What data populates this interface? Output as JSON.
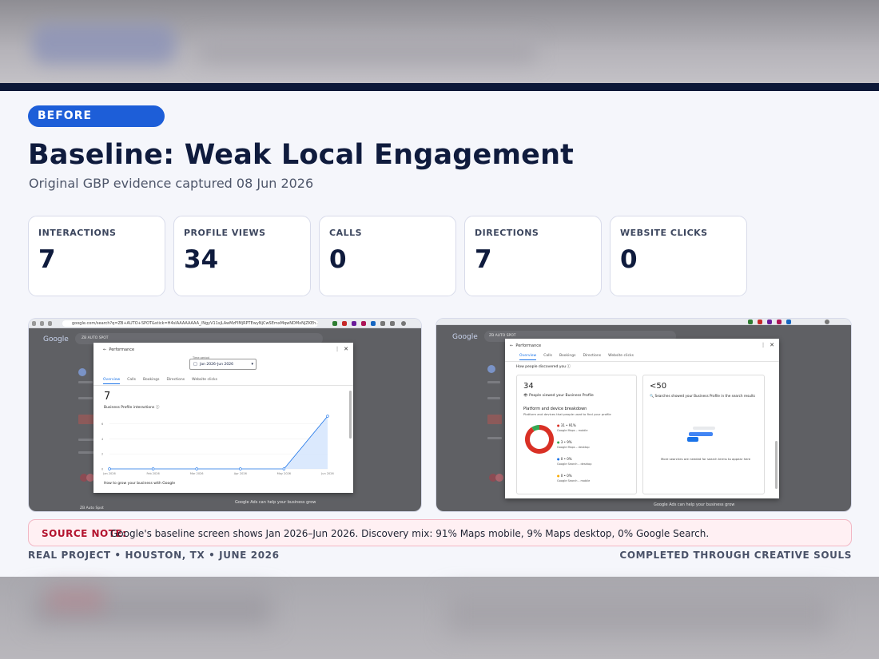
{
  "slide": {
    "badge": "BEFORE",
    "title": "Baseline: Weak Local Engagement",
    "subtitle": "Original GBP evidence captured 08 Jun 2026"
  },
  "metrics": [
    {
      "label": "INTERACTIONS",
      "value": "7"
    },
    {
      "label": "PROFILE VIEWS",
      "value": "34"
    },
    {
      "label": "CALLS",
      "value": "0"
    },
    {
      "label": "DIRECTIONS",
      "value": "7"
    },
    {
      "label": "WEBSITE CLICKS",
      "value": "0"
    }
  ],
  "screenshot_left": {
    "url": "google.com/search?q=ZB+AUTO+SPOT&stick=H4sIAAAAAAAA_/NgyV11sjLAwMzFIMjRPTEwyNjCwSEmxMqwNDMxNjZKEh...",
    "logo": "Google",
    "search_text": "ZB AUTO SPOT",
    "modal_title": "Performance",
    "time_period_label": "Time period",
    "time_period_value": "Jan 2026–Jun 2026",
    "tabs": [
      "Overview",
      "Calls",
      "Bookings",
      "Directions",
      "Website clicks"
    ],
    "big_value": "7",
    "metric_label": "Business Profile interactions",
    "y_ticks": [
      "6",
      "4",
      "2",
      "0"
    ],
    "x_ticks": [
      "Jan 2026",
      "Feb 2026",
      "Mar 2026",
      "Apr 2026",
      "May 2026",
      "Jun 2026"
    ],
    "footer_text": "How to grow your business with Google",
    "bg_text_1": "Google Ads can help your business grow",
    "bg_text_2": "ZB Auto Spot"
  },
  "screenshot_right": {
    "logo": "Google",
    "search_text": "ZB AUTO SPOT",
    "modal_title": "Performance",
    "tabs": [
      "Overview",
      "Calls",
      "Bookings",
      "Directions",
      "Website clicks"
    ],
    "section_title": "How people discovered you",
    "views_value": "34",
    "views_label": "People viewed your Business Profile",
    "breakdown_title": "Platform and device breakdown",
    "breakdown_sub": "Platform and devices that people used to find your profile",
    "breakdown": [
      {
        "pct": "31 • 91%",
        "label": "Google Maps – mobile",
        "color": "#d93025"
      },
      {
        "pct": "3 • 9%",
        "label": "Google Maps – desktop",
        "color": "#34a853"
      },
      {
        "pct": "0 • 0%",
        "label": "Google Search – desktop",
        "color": "#1a73e8"
      },
      {
        "pct": "0 • 0%",
        "label": "Google Search – mobile",
        "color": "#f9ab00"
      }
    ],
    "searches_value": "<50",
    "searches_label": "Searches showed your Business Profile in the search results",
    "searches_note": "More searches are needed for search terms to appear here",
    "bg_text_1": "Google Ads can help your business grow"
  },
  "chart_data": {
    "type": "line",
    "categories": [
      "Jan 2026",
      "Feb 2026",
      "Mar 2026",
      "Apr 2026",
      "May 2026",
      "Jun 2026"
    ],
    "values": [
      0,
      0,
      0,
      0,
      0,
      7
    ],
    "title": "Business Profile interactions",
    "ylim": [
      0,
      7
    ],
    "colors": {
      "line": "#1a73e8",
      "fill": "#d2e3fc"
    }
  },
  "donut_data": {
    "type": "pie",
    "categories": [
      "Google Maps – mobile",
      "Google Maps – desktop",
      "Google Search – desktop",
      "Google Search – mobile"
    ],
    "values": [
      91,
      9,
      0,
      0
    ]
  },
  "source_note": {
    "label": "SOURCE NOTE:",
    "text": "Google's baseline screen shows Jan 2026–Jun 2026. Discovery mix: 91% Maps mobile, 9% Maps desktop, 0% Google Search."
  },
  "footer": {
    "left": "REAL PROJECT • HOUSTON, TX • JUNE 2026",
    "right": "COMPLETED THROUGH CREATIVE SOULS"
  },
  "colors": {
    "navy": "#0c1838",
    "badge": "#1d5ed8",
    "accent_red": "#b3132e"
  }
}
